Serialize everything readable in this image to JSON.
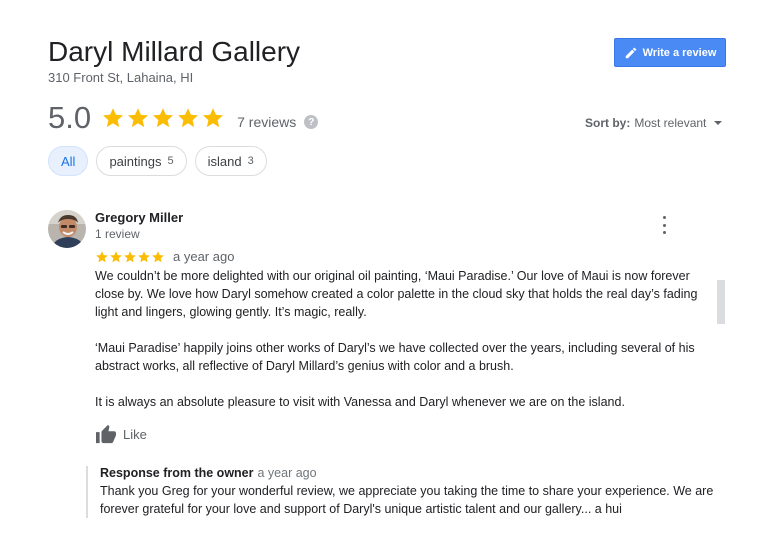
{
  "place": {
    "name": "Daryl Millard Gallery",
    "address": "310 Front St, Lahaina, HI"
  },
  "write_review": {
    "label": "Write a review",
    "icon": "pencil-icon"
  },
  "summary": {
    "rating": "5.0",
    "stars": 5,
    "review_count": "7 reviews",
    "help_icon": "?",
    "star_color": "#fbbc04"
  },
  "sort": {
    "label": "Sort by:",
    "value": "Most relevant"
  },
  "filters": [
    {
      "label": "All",
      "count": "",
      "active": true
    },
    {
      "label": "paintings",
      "count": "5",
      "active": false
    },
    {
      "label": "island",
      "count": "3",
      "active": false
    }
  ],
  "review": {
    "author": "Gregory Miller",
    "author_meta": "1 review",
    "stars": 5,
    "date": "a year ago",
    "paragraphs": [
      "We couldn’t be more delighted with our original oil painting, ‘Maui Paradise.’ Our love of Maui is now forever close by.  We love how Daryl somehow created a color palette in the cloud sky that holds the real day’s fading light and lingers, glowing gently. It’s magic, really.",
      "‘Maui Paradise’ happily joins other works of Daryl’s we have collected over the years, including several of his abstract works, all reflective of Daryl Millard’s genius with color and a brush.",
      "It is always an absolute pleasure to visit with Vanessa and Daryl whenever we are on the island."
    ],
    "like_label": "Like"
  },
  "owner_response": {
    "heading": "Response from the owner",
    "date": "a year ago",
    "text": "Thank you Greg for your wonderful review, we appreciate you taking the time to share your experience. We are forever grateful for your love and support of Daryl's unique artistic talent and our gallery... a hui"
  },
  "colors": {
    "accent_blue": "#4a8af4",
    "chip_active_bg": "#e8f0fe",
    "chip_active_text": "#1a73e8"
  }
}
